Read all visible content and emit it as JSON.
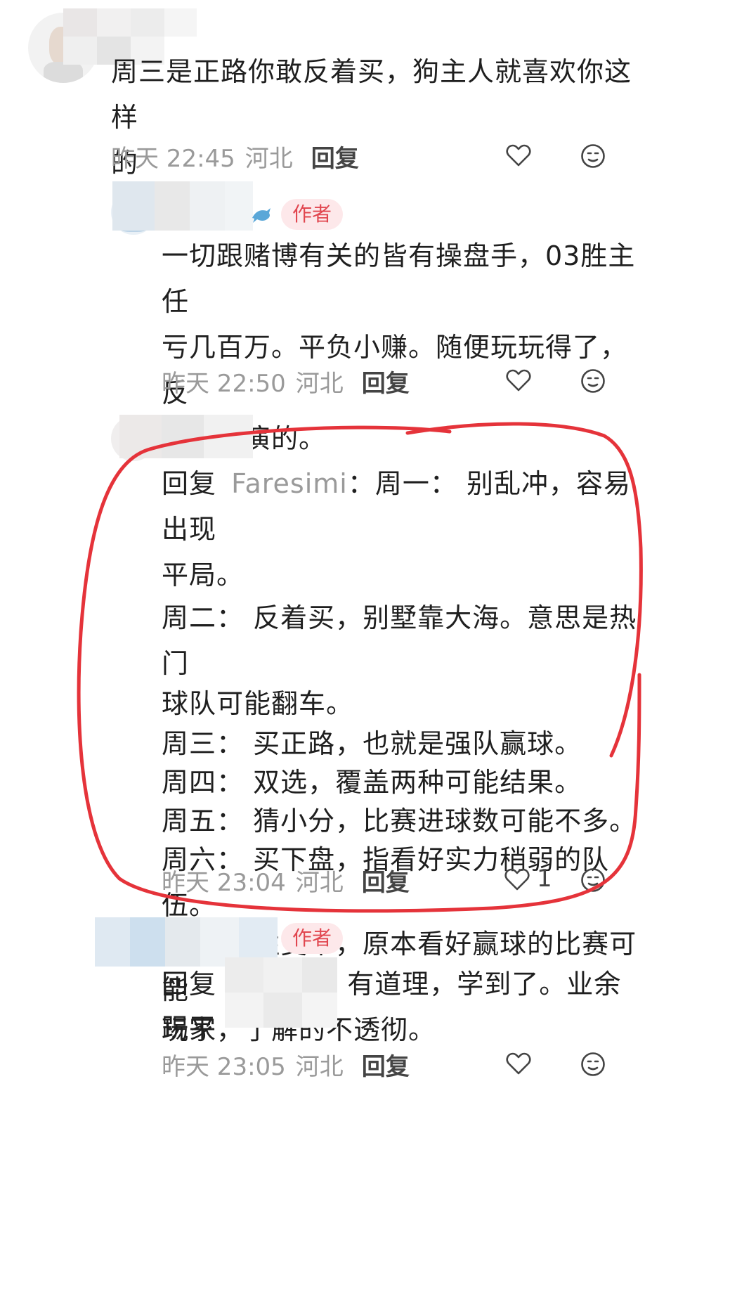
{
  "comments": [
    {
      "text_lines": [
        "周三是正路你敢反着买，狗主人就喜欢你这样",
        "的"
      ],
      "time": "昨天 22:45",
      "location": "河北",
      "reply_label": "回复"
    },
    {
      "author_badge": "作者",
      "text_lines": [
        "一切跟赌博有关的皆有操盘手，03胜主任",
        "亏几百万。平负小赚。随便玩玩得了，反",
        "正总有演的。"
      ],
      "time": "昨天 22:50",
      "location": "河北",
      "reply_label": "回复"
    },
    {
      "reply_prefix": "回复",
      "mention": "Faresimi",
      "text_lines": [
        "：周一： 别乱冲，容易出现",
        "平局。",
        "周二： 反着买，别墅靠大海。意思是热门",
        "球队可能翻车。",
        "周三： 买正路，也就是强队赢球。",
        "周四： 双选，覆盖两种可能结果。",
        "周五： 猜小分，比赛进球数可能不多。",
        "周六： 买下盘，指看好实力稍弱的队伍。",
        "周日： 胜变平，原本看好赢球的比赛可能",
        "踢平"
      ],
      "time": "昨天 23:04",
      "location": "河北",
      "reply_label": "回复",
      "like_count": "1"
    },
    {
      "author_badge": "作者",
      "reply_prefix": "回复",
      "text_lines": [
        "有道理，学到了。业余",
        "玩家，了解的不透彻。"
      ],
      "time": "昨天 23:05",
      "location": "河北",
      "reply_label": "回复"
    }
  ],
  "icons": {
    "like": "heart-outline-icon",
    "emoji": "smiley-face-icon"
  },
  "colors": {
    "annotation_red": "#e5333a",
    "author_badge_bg": "#fde8ea",
    "author_badge_text": "#e1464f",
    "meta_gray": "#9a9a9a"
  }
}
